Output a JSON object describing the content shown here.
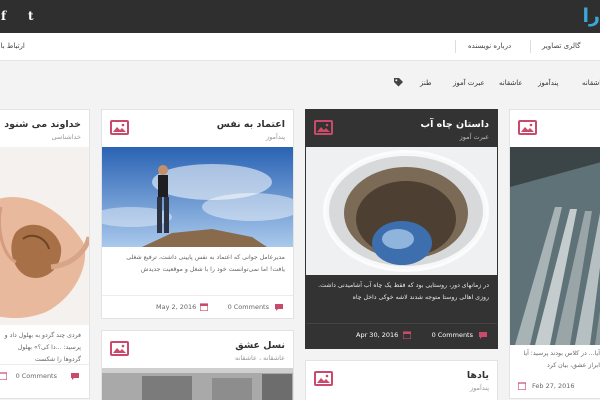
{
  "header": {
    "logo": "را",
    "social": {
      "twitter": "t",
      "facebook": "f"
    }
  },
  "subnav": {
    "items": [
      "گالری تصاویر",
      "درباره نویسنده",
      "ارتباط با م"
    ]
  },
  "categories": [
    "عاشقانه",
    "پندآموز",
    "عاشقانه",
    "عبرت آموز",
    "طنز"
  ],
  "colors": {
    "accent": "#c94a6a",
    "logo": "#3aa7d8",
    "header_bg": "#2f2f2f"
  },
  "cards": [
    {
      "title": "خداوند می شنود",
      "category": "خداشناسی",
      "text": "فردی چند گردو به بهلول داد و پرسید: ...دا کی؟» بهلول گردوها را شکست",
      "comments": "0 Comments"
    },
    {
      "title": "اعتماد به نفس",
      "category": "پندآموز",
      "text": "مدیرعامل جوانی که اعتماد به نفس پایینی داشت، ترفیع شغلی یافت! اما نمی‌توانست خود را با شغل و موقعیت جدیدش",
      "comments": "0 Comments",
      "date": "May 2, 2016"
    },
    {
      "title": "داستان چاه آب",
      "category": "عبرت آموز",
      "text": "در زمانهای دور، روستایی بود که فقط یک چاه آب آشامیدنی داشت. روزی اهالی روستا متوجه شدند لاشه خوکی داخل چاه",
      "comments": "0 Comments",
      "date": "Apr 30, 2016"
    },
    {
      "title": "آیا",
      "text": "آیا... در کلاس بودند پرسید: آیا ابراز عشق، بیان کرد",
      "date": "Feb 27, 2016"
    },
    {
      "title": "نسل عشق",
      "category": "عاشقانه ، عاشقانه"
    },
    {
      "title": "یادها",
      "category": "پندآموز"
    }
  ],
  "icons": {
    "card": "image-icon",
    "comments": "comment-icon",
    "date": "calendar-icon",
    "tag": "tag-icon"
  }
}
